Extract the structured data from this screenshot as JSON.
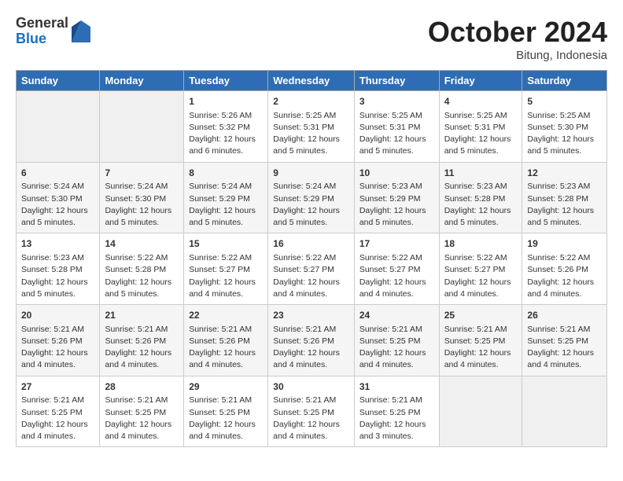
{
  "header": {
    "logo_general": "General",
    "logo_blue": "Blue",
    "month_title": "October 2024",
    "location": "Bitung, Indonesia"
  },
  "days_of_week": [
    "Sunday",
    "Monday",
    "Tuesday",
    "Wednesday",
    "Thursday",
    "Friday",
    "Saturday"
  ],
  "weeks": [
    [
      {
        "day": "",
        "info": ""
      },
      {
        "day": "",
        "info": ""
      },
      {
        "day": "1",
        "info": "Sunrise: 5:26 AM\nSunset: 5:32 PM\nDaylight: 12 hours and 6 minutes."
      },
      {
        "day": "2",
        "info": "Sunrise: 5:25 AM\nSunset: 5:31 PM\nDaylight: 12 hours and 5 minutes."
      },
      {
        "day": "3",
        "info": "Sunrise: 5:25 AM\nSunset: 5:31 PM\nDaylight: 12 hours and 5 minutes."
      },
      {
        "day": "4",
        "info": "Sunrise: 5:25 AM\nSunset: 5:31 PM\nDaylight: 12 hours and 5 minutes."
      },
      {
        "day": "5",
        "info": "Sunrise: 5:25 AM\nSunset: 5:30 PM\nDaylight: 12 hours and 5 minutes."
      }
    ],
    [
      {
        "day": "6",
        "info": "Sunrise: 5:24 AM\nSunset: 5:30 PM\nDaylight: 12 hours and 5 minutes."
      },
      {
        "day": "7",
        "info": "Sunrise: 5:24 AM\nSunset: 5:30 PM\nDaylight: 12 hours and 5 minutes."
      },
      {
        "day": "8",
        "info": "Sunrise: 5:24 AM\nSunset: 5:29 PM\nDaylight: 12 hours and 5 minutes."
      },
      {
        "day": "9",
        "info": "Sunrise: 5:24 AM\nSunset: 5:29 PM\nDaylight: 12 hours and 5 minutes."
      },
      {
        "day": "10",
        "info": "Sunrise: 5:23 AM\nSunset: 5:29 PM\nDaylight: 12 hours and 5 minutes."
      },
      {
        "day": "11",
        "info": "Sunrise: 5:23 AM\nSunset: 5:28 PM\nDaylight: 12 hours and 5 minutes."
      },
      {
        "day": "12",
        "info": "Sunrise: 5:23 AM\nSunset: 5:28 PM\nDaylight: 12 hours and 5 minutes."
      }
    ],
    [
      {
        "day": "13",
        "info": "Sunrise: 5:23 AM\nSunset: 5:28 PM\nDaylight: 12 hours and 5 minutes."
      },
      {
        "day": "14",
        "info": "Sunrise: 5:22 AM\nSunset: 5:28 PM\nDaylight: 12 hours and 5 minutes."
      },
      {
        "day": "15",
        "info": "Sunrise: 5:22 AM\nSunset: 5:27 PM\nDaylight: 12 hours and 4 minutes."
      },
      {
        "day": "16",
        "info": "Sunrise: 5:22 AM\nSunset: 5:27 PM\nDaylight: 12 hours and 4 minutes."
      },
      {
        "day": "17",
        "info": "Sunrise: 5:22 AM\nSunset: 5:27 PM\nDaylight: 12 hours and 4 minutes."
      },
      {
        "day": "18",
        "info": "Sunrise: 5:22 AM\nSunset: 5:27 PM\nDaylight: 12 hours and 4 minutes."
      },
      {
        "day": "19",
        "info": "Sunrise: 5:22 AM\nSunset: 5:26 PM\nDaylight: 12 hours and 4 minutes."
      }
    ],
    [
      {
        "day": "20",
        "info": "Sunrise: 5:21 AM\nSunset: 5:26 PM\nDaylight: 12 hours and 4 minutes."
      },
      {
        "day": "21",
        "info": "Sunrise: 5:21 AM\nSunset: 5:26 PM\nDaylight: 12 hours and 4 minutes."
      },
      {
        "day": "22",
        "info": "Sunrise: 5:21 AM\nSunset: 5:26 PM\nDaylight: 12 hours and 4 minutes."
      },
      {
        "day": "23",
        "info": "Sunrise: 5:21 AM\nSunset: 5:26 PM\nDaylight: 12 hours and 4 minutes."
      },
      {
        "day": "24",
        "info": "Sunrise: 5:21 AM\nSunset: 5:25 PM\nDaylight: 12 hours and 4 minutes."
      },
      {
        "day": "25",
        "info": "Sunrise: 5:21 AM\nSunset: 5:25 PM\nDaylight: 12 hours and 4 minutes."
      },
      {
        "day": "26",
        "info": "Sunrise: 5:21 AM\nSunset: 5:25 PM\nDaylight: 12 hours and 4 minutes."
      }
    ],
    [
      {
        "day": "27",
        "info": "Sunrise: 5:21 AM\nSunset: 5:25 PM\nDaylight: 12 hours and 4 minutes."
      },
      {
        "day": "28",
        "info": "Sunrise: 5:21 AM\nSunset: 5:25 PM\nDaylight: 12 hours and 4 minutes."
      },
      {
        "day": "29",
        "info": "Sunrise: 5:21 AM\nSunset: 5:25 PM\nDaylight: 12 hours and 4 minutes."
      },
      {
        "day": "30",
        "info": "Sunrise: 5:21 AM\nSunset: 5:25 PM\nDaylight: 12 hours and 4 minutes."
      },
      {
        "day": "31",
        "info": "Sunrise: 5:21 AM\nSunset: 5:25 PM\nDaylight: 12 hours and 3 minutes."
      },
      {
        "day": "",
        "info": ""
      },
      {
        "day": "",
        "info": ""
      }
    ]
  ]
}
